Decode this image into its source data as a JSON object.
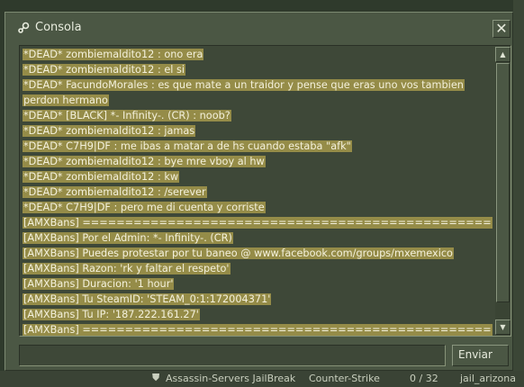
{
  "window": {
    "title": "Consola",
    "icon": "steam-icon",
    "close_label": "✕"
  },
  "log": [
    "*DEAD* zombiemaldito12 :  ono era",
    "*DEAD* zombiemaldito12 : el si",
    "*DEAD* FacundoMorales : es que mate a un traidor y pense que eras uno vos tambien",
    "perdon hermano",
    "*DEAD* [BLACK] *- Infinity-. (CR) : noob?",
    "*DEAD* zombiemaldito12 : jamas",
    "*DEAD* C7H9|DF :  me ibas a matar a de hs cuando estaba \"afk\"",
    "*DEAD* zombiemaldito12 : bye  mre vboy al hw",
    "*DEAD* zombiemaldito12 : kw",
    "*DEAD* zombiemaldito12 : /serever",
    "*DEAD* C7H9|DF : pero me di cuenta y corriste",
    "[AMXBans] ================================================",
    "[AMXBans] Por el Admin: *- Infinity-. (CR)",
    "[AMXBans] Puedes protestar por tu baneo @ www.facebook.com/groups/mxemexico",
    "[AMXBans] Razon: 'rk y faltar el respeto'",
    "[AMXBans] Duracion: '1 hour'",
    "[AMXBans] Tu SteamID: 'STEAM_0:1:172004371'",
    "[AMXBans] Tu IP: '187.222.161.27'",
    "[AMXBans] ================================================"
  ],
  "input": {
    "value": "",
    "placeholder": ""
  },
  "send_label": "Enviar",
  "background_row": {
    "server_name": "Assassin-Servers JailBreak",
    "game": "Counter-Strike",
    "players": "0 / 32",
    "map": "jail_arizona"
  },
  "colors": {
    "window_bg": "#4b5744",
    "text_highlight": "#958c48",
    "text": "#f4f1dc"
  }
}
